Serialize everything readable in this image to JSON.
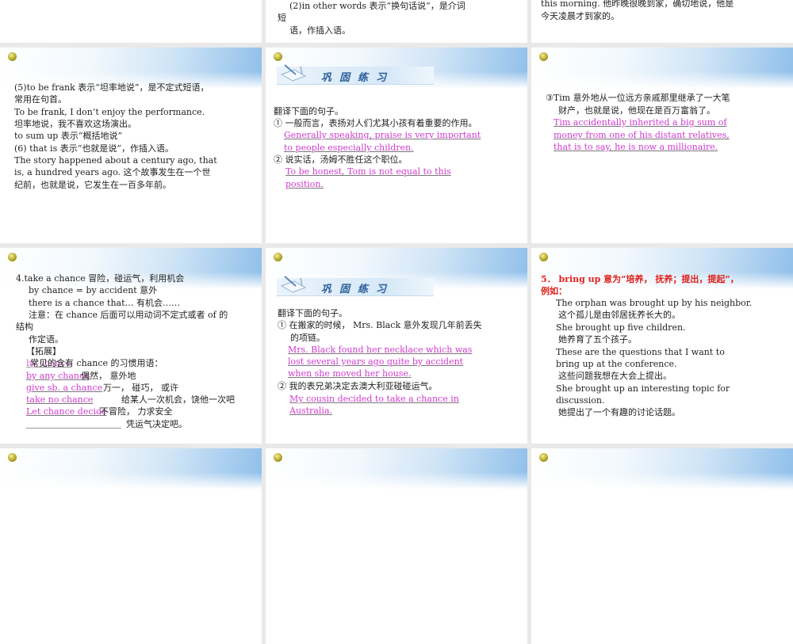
{
  "slides": [
    {
      "id": "top-1",
      "lines": []
    },
    {
      "id": "top-2",
      "lines": [
        "(2)in other words 表示“换句话说”，是介词",
        "短",
        "语，作插入语。"
      ]
    },
    {
      "id": "top-3",
      "lines": [
        "this morning. 他昨晚很晚到家，确切地说，他是",
        "今天凌晨才到家的。"
      ]
    },
    {
      "id": "s-frank",
      "lines": [
        "(5)to be frank 表示“坦率地说”，是不定式短语，",
        "常用在句首。",
        "To be frank, I don’t enjoy the performance.",
        "坦率地说，我不喜欢这场演出。",
        "to sum up 表示“概括地说”",
        "(6) that is 表示“也就是说”，作插入语。",
        "The story happened about a century ago, that",
        "is, a hundred years ago.  这个故事发生在一个世",
        "纪前，也就是说，它发生在一百多年前。"
      ]
    },
    {
      "id": "s-practice-1",
      "banner": "巩固练习",
      "lines": [
        "翻译下面的句子。",
        "① 一般而言，表扬对人们尤其小孩有着重要的作用。",
        "② 说实话，汤姆不胜任这个职位。"
      ],
      "answers": [
        "Generally speaking, praise is very important",
        "to people especially children.",
        "To be honest, Tom is not equal to this",
        "position."
      ]
    },
    {
      "id": "s-tim",
      "lines": [
        "③Tim 意外地从一位远方亲戚那里继承了一大笔",
        "财产，也就是说，他现在是百万富翁了。"
      ],
      "answers": [
        "Tim accidentally inherited a big sum of",
        "money from one of his distant relatives,",
        "that is to say, he is now a millionaire."
      ]
    },
    {
      "id": "s-chance",
      "lines": [
        "4.take a chance  冒险，碰运气，利用机会",
        "by chance = by accident 意外",
        "there is a chance that…  有机会……",
        "注意：在 chance 后面可以用动词不定式或者 of 的",
        "结构",
        "作定语。",
        "【拓展】",
        "常见的含有 chance 的习惯用语：",
        "偶然， 意外地",
        "万一， 碰巧， 或许",
        "给某人一次机会，饶他一次吧",
        "不冒险， 力求安全",
        "凭运气决定吧。"
      ],
      "answers": [
        "by chance",
        "by any chance",
        "give sb. a chance",
        "take no chance",
        "Let chance decide"
      ]
    },
    {
      "id": "s-practice-2",
      "banner": "巩固练习",
      "lines": [
        "翻译下面的句子。",
        "① 在搬家的时候， Mrs. Black 意外发现几年前丢失",
        "的项链。",
        "② 我的表兄弟决定去澳大利亚碰碰运气。"
      ],
      "answers": [
        "Mrs. Black found her necklace which was",
        "lost several years ago quite by accident",
        "when she moved her house.",
        "My cousin decided to take a chance in",
        "Australia."
      ]
    },
    {
      "id": "s-bringup",
      "heading": [
        "5． bring up 意为“培养， 抚养；提出，提起”，",
        "例如："
      ],
      "lines": [
        "The orphan was brought up by his neighbor.",
        "这个孤儿是由邻居抚养长大的。",
        "She brought up five children.",
        "她养育了五个孩子。",
        "These are the questions that I want to",
        "bring up at the conference.",
        "这些问题我想在大会上提出。",
        "She brought up an interesting topic for",
        "discussion.",
        "她提出了一个有趣的讨论话题。"
      ]
    }
  ]
}
